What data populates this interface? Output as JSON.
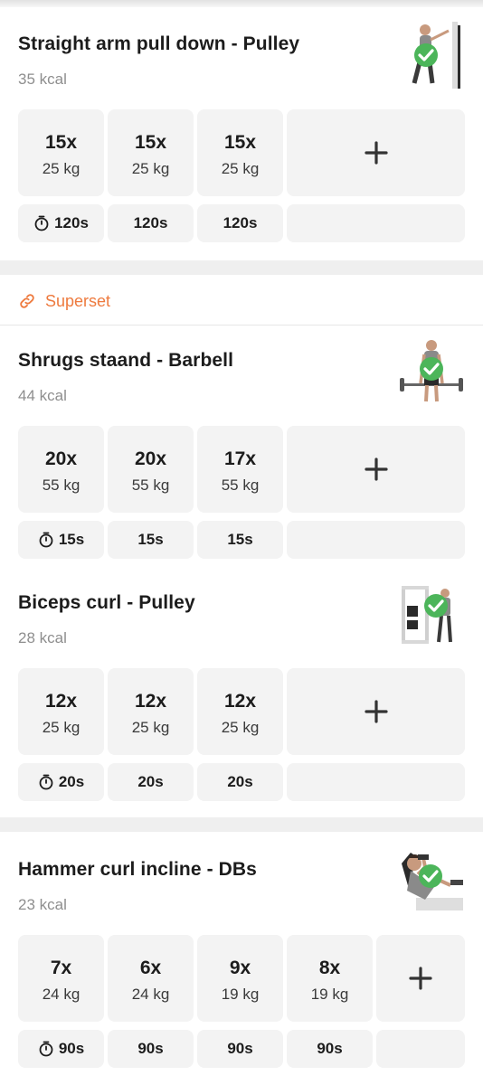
{
  "superset_label": "Superset",
  "colors": {
    "accent": "#ee7a3e",
    "check": "#4cb55a",
    "cell_bg": "#f3f3f3"
  },
  "exercises": [
    {
      "title": "Straight arm pull down - Pulley",
      "kcal": "35 kcal",
      "completed_icon": "check-circle-icon",
      "sets": [
        {
          "reps": "15x",
          "weight": "25 kg"
        },
        {
          "reps": "15x",
          "weight": "25 kg"
        },
        {
          "reps": "15x",
          "weight": "25 kg"
        }
      ],
      "rests": [
        "120s",
        "120s",
        "120s"
      ]
    },
    {
      "title": "Shrugs staand - Barbell",
      "kcal": "44 kcal",
      "completed_icon": "check-circle-icon",
      "sets": [
        {
          "reps": "20x",
          "weight": "55 kg"
        },
        {
          "reps": "20x",
          "weight": "55 kg"
        },
        {
          "reps": "17x",
          "weight": "55 kg"
        }
      ],
      "rests": [
        "15s",
        "15s",
        "15s"
      ]
    },
    {
      "title": "Biceps curl - Pulley",
      "kcal": "28 kcal",
      "completed_icon": "check-circle-icon",
      "sets": [
        {
          "reps": "12x",
          "weight": "25 kg"
        },
        {
          "reps": "12x",
          "weight": "25 kg"
        },
        {
          "reps": "12x",
          "weight": "25 kg"
        }
      ],
      "rests": [
        "20s",
        "20s",
        "20s"
      ]
    },
    {
      "title": "Hammer curl incline - DBs",
      "kcal": "23 kcal",
      "completed_icon": "check-circle-icon",
      "sets": [
        {
          "reps": "7x",
          "weight": "24 kg"
        },
        {
          "reps": "6x",
          "weight": "24 kg"
        },
        {
          "reps": "9x",
          "weight": "19 kg"
        },
        {
          "reps": "8x",
          "weight": "19 kg"
        }
      ],
      "rests": [
        "90s",
        "90s",
        "90s",
        "90s"
      ]
    }
  ]
}
